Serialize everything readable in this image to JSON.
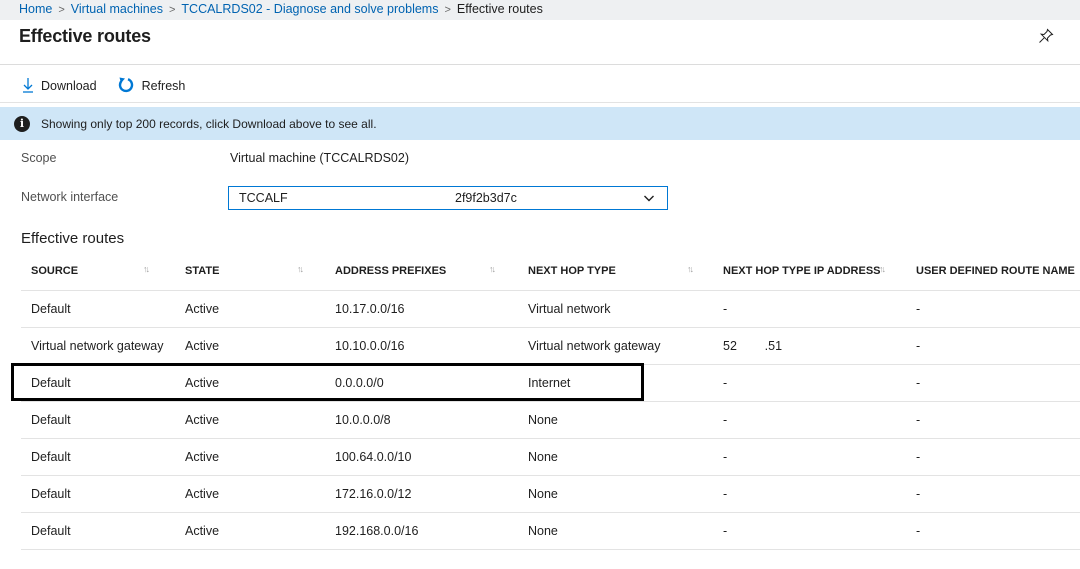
{
  "breadcrumb": {
    "items": [
      "Home",
      "Virtual machines",
      "TCCALRDS02 - Diagnose and solve problems"
    ],
    "current": "Effective routes",
    "separator": ">"
  },
  "page": {
    "title": "Effective routes"
  },
  "toolbar": {
    "download_label": "Download",
    "refresh_label": "Refresh"
  },
  "info_bar": {
    "text": "Showing only top 200 records, click Download above to see all."
  },
  "scope": {
    "label": "Scope",
    "value": "Virtual machine (TCCALRDS02)"
  },
  "network_interface": {
    "label": "Network interface",
    "value_left": "TCCALF",
    "value_right": "2f9f2b3d7c"
  },
  "routes": {
    "title": "Effective routes",
    "columns": [
      "SOURCE",
      "STATE",
      "ADDRESS PREFIXES",
      "NEXT HOP TYPE",
      "NEXT HOP TYPE IP ADDRESS",
      "USER DEFINED ROUTE NAME"
    ],
    "rows": [
      [
        "Default",
        "Active",
        "10.17.0.0/16",
        "Virtual network",
        "-",
        "-"
      ],
      [
        "Virtual network gateway",
        "Active",
        "10.10.0.0/16",
        "Virtual network gateway",
        "52        .51",
        "-"
      ],
      [
        "Default",
        "Active",
        "0.0.0.0/0",
        "Internet",
        "-",
        "-"
      ],
      [
        "Default",
        "Active",
        "10.0.0.0/8",
        "None",
        "-",
        "-"
      ],
      [
        "Default",
        "Active",
        "100.64.0.0/10",
        "None",
        "-",
        "-"
      ],
      [
        "Default",
        "Active",
        "172.16.0.0/12",
        "None",
        "-",
        "-"
      ],
      [
        "Default",
        "Active",
        "192.168.0.0/16",
        "None",
        "-",
        "-"
      ]
    ],
    "highlighted_row": 2
  },
  "colors": {
    "link": "#0063b1",
    "info_bg": "#cfe6f7",
    "accent": "#0078d4"
  },
  "icons": [
    "download-icon",
    "refresh-icon",
    "info-icon",
    "pin-icon",
    "chevron-down-icon",
    "sort-icon"
  ]
}
